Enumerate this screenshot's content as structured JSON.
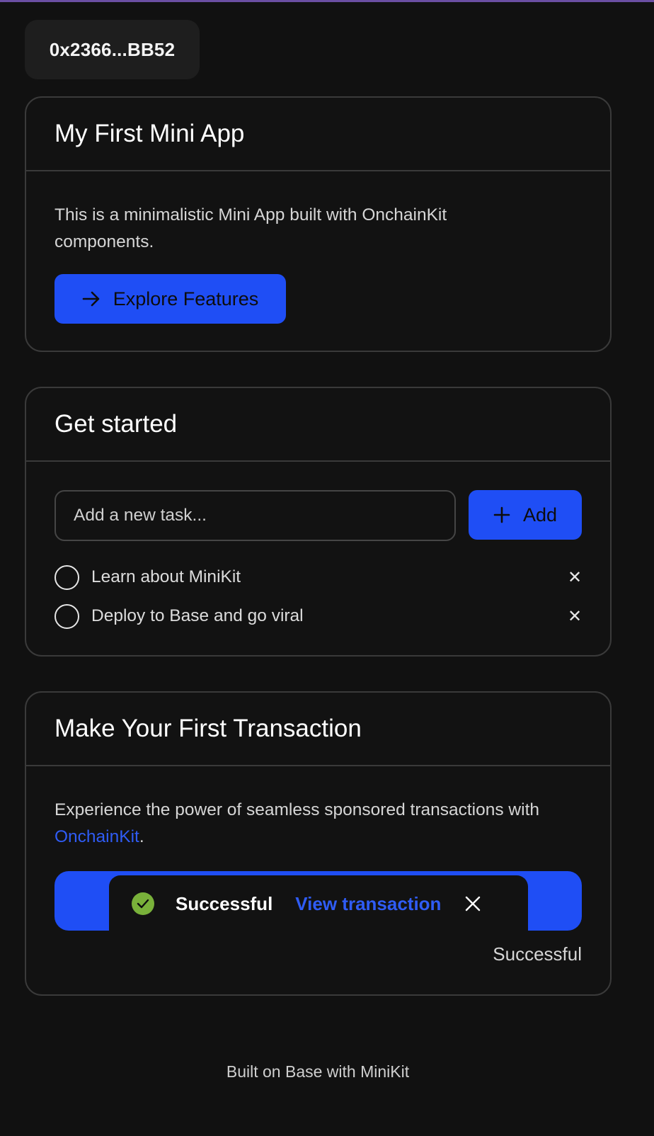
{
  "wallet": {
    "address": "0x2366...BB52"
  },
  "intro": {
    "title": "My First Mini App",
    "description": "This is a minimalistic Mini App built with OnchainKit components.",
    "button_label": "Explore Features",
    "button_icon": "arrow-right-icon"
  },
  "todo": {
    "title": "Get started",
    "input_placeholder": "Add a new task...",
    "add_label": "Add",
    "add_icon": "plus-icon",
    "tasks": [
      {
        "label": "Learn about MiniKit",
        "done": false
      },
      {
        "label": "Deploy to Base and go viral",
        "done": false
      }
    ]
  },
  "transaction": {
    "title": "Make Your First Transaction",
    "description_prefix": "Experience the power of seamless sponsored transactions with ",
    "description_link": "OnchainKit",
    "description_suffix": ".",
    "toast_status": "Successful",
    "toast_link": "View transaction",
    "status_text": "Successful"
  },
  "footer": {
    "text": "Built on Base with MiniKit"
  },
  "colors": {
    "background": "#111111",
    "accent_blue": "#1f4ef5",
    "link_blue": "#2f5cf5",
    "success_green": "#79b13a",
    "border": "#3a3a3a"
  }
}
